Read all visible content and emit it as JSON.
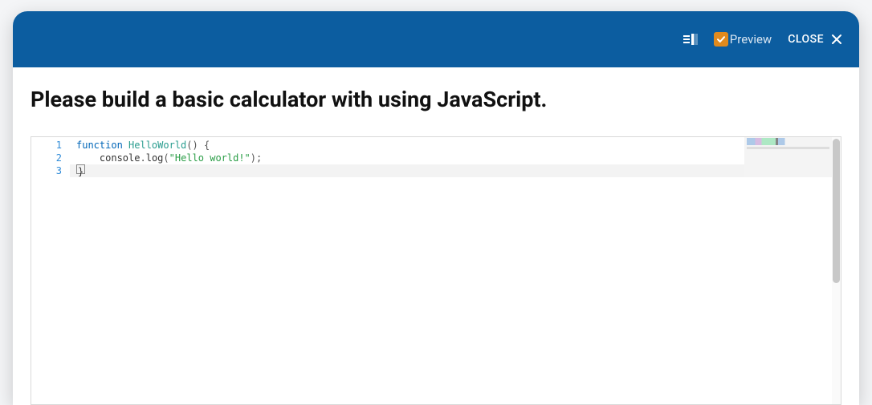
{
  "header": {
    "preview_label": "Preview",
    "close_label": "CLOSE",
    "preview_checked": true
  },
  "title": "Please build a basic calculator with using JavaScript.",
  "editor": {
    "line_numbers": [
      "1",
      "2",
      "3"
    ],
    "active_line_index": 2,
    "tokens": [
      [
        {
          "t": "function",
          "c": "kw"
        },
        {
          "t": " ",
          "c": "plain"
        },
        {
          "t": "HelloWorld",
          "c": "fn"
        },
        {
          "t": "() {",
          "c": "punc"
        }
      ],
      [
        {
          "t": "    console",
          "c": "plain"
        },
        {
          "t": ".",
          "c": "punc"
        },
        {
          "t": "log",
          "c": "plain"
        },
        {
          "t": "(",
          "c": "punc"
        },
        {
          "t": "\"Hello world!\"",
          "c": "str"
        },
        {
          "t": ");",
          "c": "punc"
        }
      ],
      [
        {
          "t": "}",
          "c": "caret-after"
        }
      ]
    ]
  }
}
